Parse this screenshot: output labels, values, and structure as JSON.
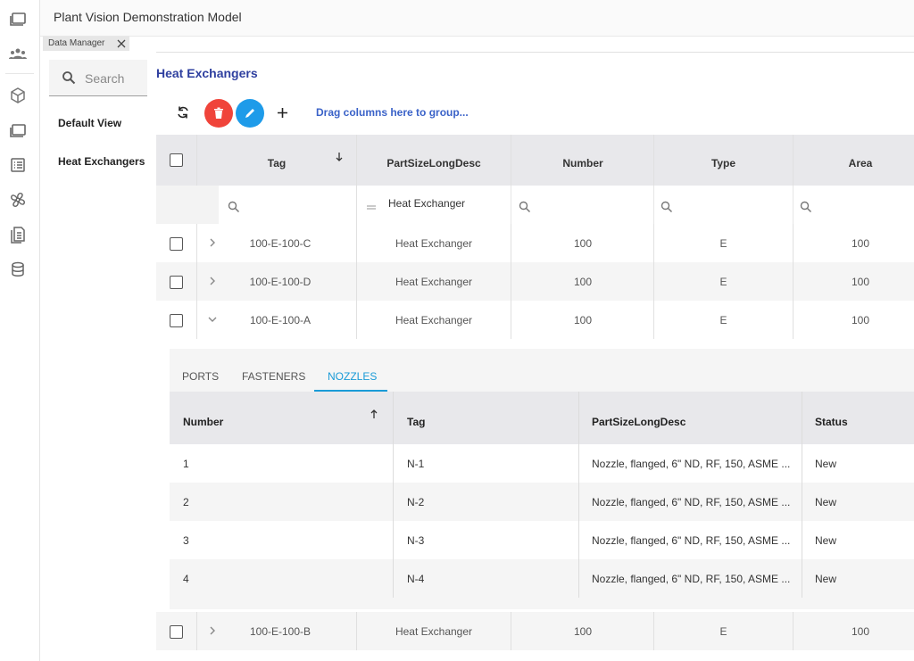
{
  "app": {
    "title": "Plant Vision Demonstration Model"
  },
  "doc_tab": {
    "label": "Data Manager"
  },
  "sidebar": {
    "search_placeholder": "Search",
    "items": [
      {
        "label": "Default View"
      },
      {
        "label": "Heat Exchangers"
      }
    ]
  },
  "main": {
    "title": "Heat Exchangers",
    "drag_hint": "Drag columns here to group...",
    "colors": {
      "delete": "#f0443a",
      "edit": "#1e9be9",
      "title": "#2e3f9f",
      "active_tab": "#1a9bd7"
    },
    "columns": [
      "Tag",
      "PartSizeLongDesc",
      "Number",
      "Type",
      "Area"
    ],
    "filter": {
      "part_size_value": "Heat Exchanger"
    },
    "rows": [
      {
        "tag": "100-E-100-C",
        "desc": "Heat Exchanger",
        "number": "100",
        "type": "E",
        "area": "100"
      },
      {
        "tag": "100-E-100-D",
        "desc": "Heat Exchanger",
        "number": "100",
        "type": "E",
        "area": "100"
      },
      {
        "tag": "100-E-100-A",
        "desc": "Heat Exchanger",
        "number": "100",
        "type": "E",
        "area": "100"
      },
      {
        "tag": "100-E-100-B",
        "desc": "Heat Exchanger",
        "number": "100",
        "type": "E",
        "area": "100"
      }
    ],
    "detail": {
      "tabs": [
        "PORTS",
        "FASTENERS",
        "NOZZLES"
      ],
      "active_tab": "NOZZLES",
      "columns": [
        "Number",
        "Tag",
        "PartSizeLongDesc",
        "Status"
      ],
      "rows": [
        {
          "number": "1",
          "tag": "N-1",
          "desc": "Nozzle, flanged, 6\" ND, RF, 150, ASME ...",
          "status": "New"
        },
        {
          "number": "2",
          "tag": "N-2",
          "desc": "Nozzle, flanged, 6\" ND, RF, 150, ASME ...",
          "status": "New"
        },
        {
          "number": "3",
          "tag": "N-3",
          "desc": "Nozzle, flanged, 6\" ND, RF, 150, ASME ...",
          "status": "New"
        },
        {
          "number": "4",
          "tag": "N-4",
          "desc": "Nozzle, flanged, 6\" ND, RF, 150, ASME ...",
          "status": "New"
        }
      ]
    }
  }
}
